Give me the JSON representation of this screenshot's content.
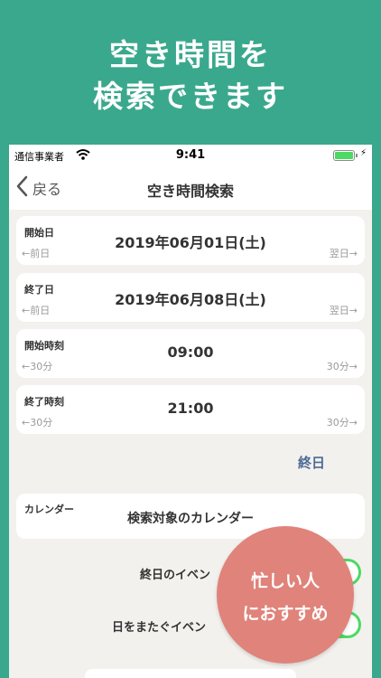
{
  "headline": {
    "line1": "空き時間を",
    "line2": "検索できます"
  },
  "status_bar": {
    "carrier": "通信事業者",
    "time": "9:41",
    "battery_level": 1.0,
    "bolt": "⚡"
  },
  "nav": {
    "back_label": "戻る",
    "title": "空き時間検索"
  },
  "fields": [
    {
      "label": "開始日",
      "value": "2019年06月01日(土)",
      "prev": "←前日",
      "next": "翌日→"
    },
    {
      "label": "終了日",
      "value": "2019年06月08日(土)",
      "prev": "←前日",
      "next": "翌日→"
    },
    {
      "label": "開始時刻",
      "value": "09:00",
      "prev": "←30分",
      "next": "30分→"
    },
    {
      "label": "終了時刻",
      "value": "21:00",
      "prev": "←30分",
      "next": "30分→"
    }
  ],
  "all_day_button": "終日",
  "calendar": {
    "label": "カレンダー",
    "value": "検索対象のカレンダー"
  },
  "toggles": [
    {
      "label": "終日のイベン",
      "on": true
    },
    {
      "label": "日をまたぐイベン",
      "on": true
    }
  ],
  "badge": {
    "line1": "忙しい人",
    "line2": "におすすめ"
  },
  "colors": {
    "background": "#3aa88d",
    "badge": "#e0837a",
    "accent": "#4b6a94",
    "toggle_on": "#4cd964"
  }
}
